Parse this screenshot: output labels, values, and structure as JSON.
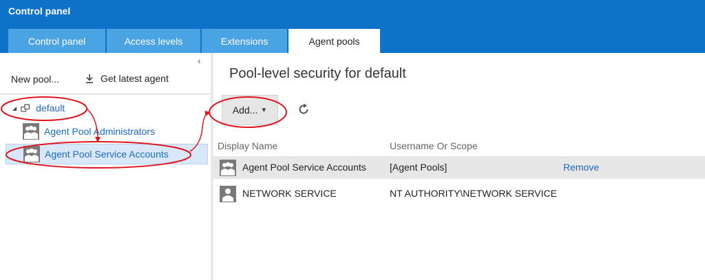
{
  "header": {
    "app_title": "Control panel",
    "tabs": [
      {
        "label": "Control panel"
      },
      {
        "label": "Access levels"
      },
      {
        "label": "Extensions"
      },
      {
        "label": "Agent pools",
        "active": true
      }
    ]
  },
  "left": {
    "new_pool": "New pool...",
    "get_latest_agent": "Get latest agent",
    "tree": {
      "root": "default",
      "items": [
        {
          "label": "Agent Pool Administrators"
        },
        {
          "label": "Agent Pool Service Accounts",
          "selected": true
        }
      ]
    }
  },
  "right": {
    "title": "Pool-level security for default",
    "add_label": "Add...",
    "columns": [
      "Display Name",
      "Username Or Scope"
    ],
    "rows": [
      {
        "display_name": "Agent Pool Service Accounts",
        "scope": "[Agent Pools]",
        "action": "Remove"
      },
      {
        "display_name": "NETWORK SERVICE",
        "scope": "NT AUTHORITY\\NETWORK SERVICE"
      }
    ]
  },
  "colors": {
    "header_blue": "#0e72c8",
    "tab_blue": "#4aa3e3",
    "link_blue": "#1b6ac9",
    "annotation_red": "#e0141e",
    "selection_bg": "#d8e8f8"
  }
}
